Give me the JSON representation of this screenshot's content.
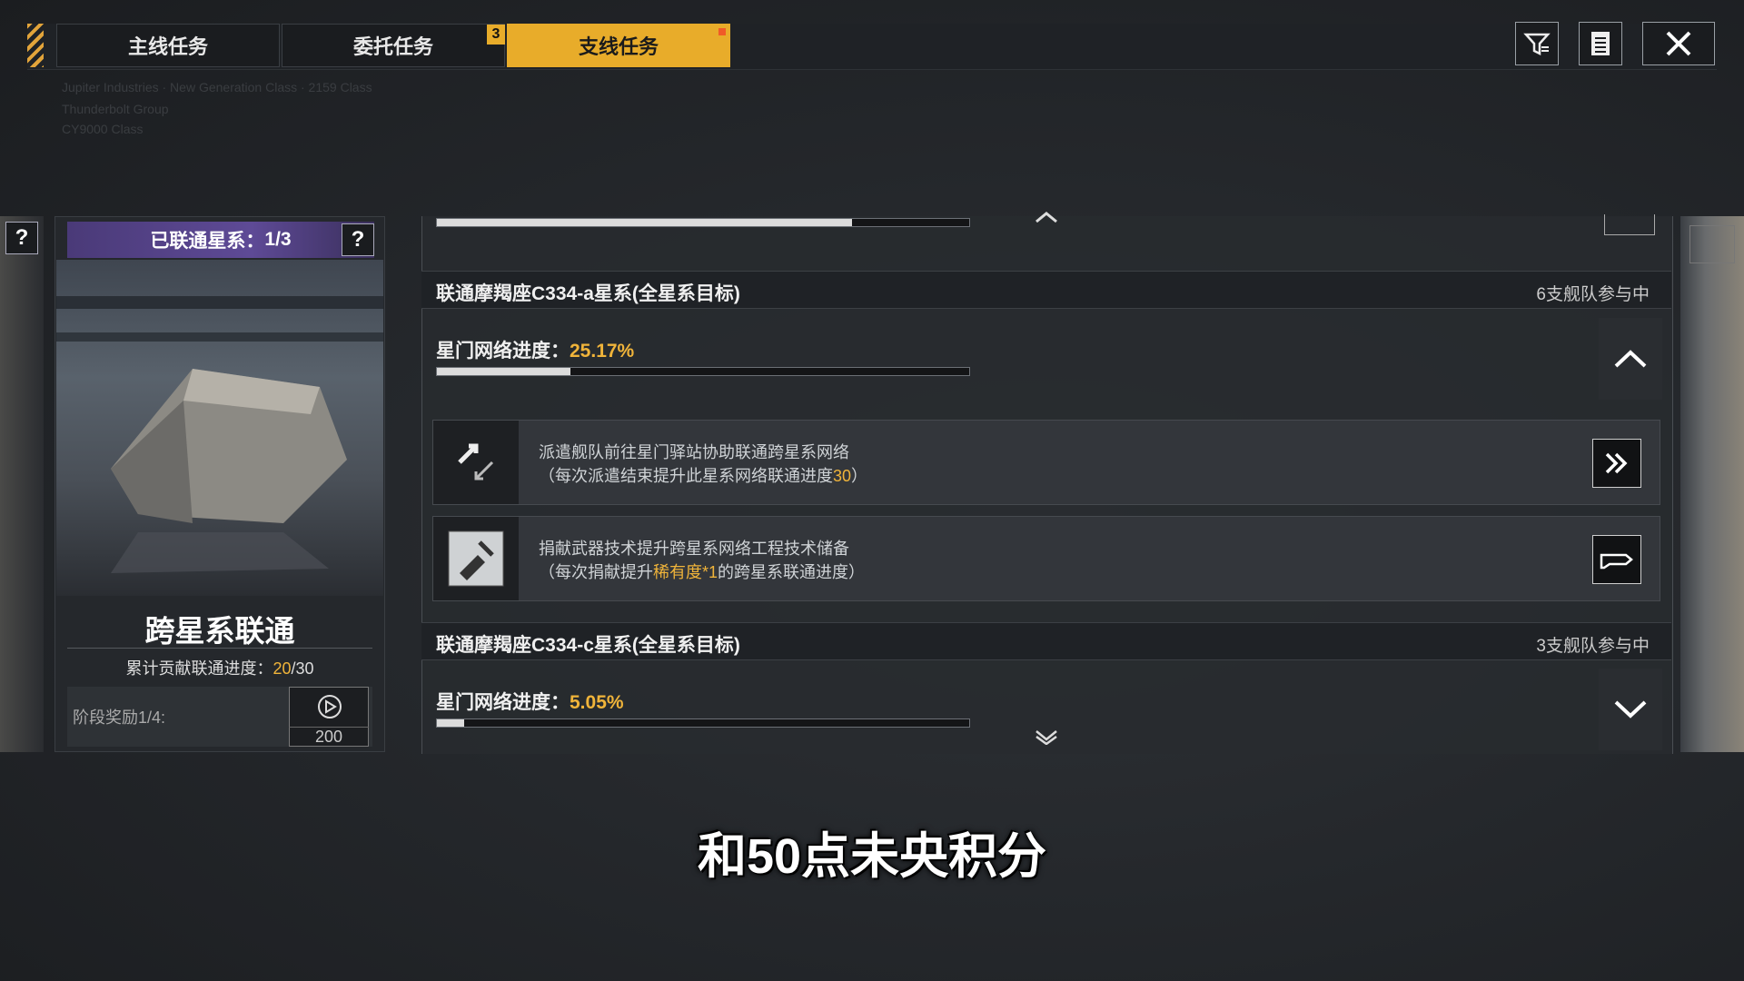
{
  "tabs": [
    {
      "label": "主线任务",
      "active": false
    },
    {
      "label": "委托任务",
      "active": false,
      "badge": "3"
    },
    {
      "label": "支线任务",
      "active": true
    }
  ],
  "header_faint_text": [
    "Jupiter Industries · New Generation Class · 2159 Class",
    "Thunderbolt Group",
    "CY9000 Class"
  ],
  "top_buttons": {
    "filter_icon": "filter-icon",
    "list_icon": "list-icon",
    "close_icon": "close-icon"
  },
  "left_card": {
    "connected_label": "已联通星系：",
    "connected_value": "1/3",
    "title": "跨星系联通",
    "contrib_label": "累计贡献联通进度：",
    "contrib_current": "20",
    "contrib_total": "/30",
    "stage_label": "阶段奖励1/4:",
    "reward_value": "200",
    "help_icon": "?"
  },
  "top_partial_progress": 0.78,
  "sections": [
    {
      "title": "联通摩羯座C334-a星系(全星系目标)",
      "fleet_text": "6支舰队参与中",
      "progress_label": "星门网络进度：",
      "progress_value": "25.17%",
      "progress_fraction": 0.2517,
      "expanded": true
    },
    {
      "title": "联通摩羯座C334-c星系(全星系目标)",
      "fleet_text": "3支舰队参与中",
      "progress_label": "星门网络进度：",
      "progress_value": "5.05%",
      "progress_fraction": 0.0505,
      "expanded": false
    }
  ],
  "tasks": [
    {
      "line1": "派遣舰队前往星门驿站协助联通跨星系网络",
      "line2_pre": "（每次派遣结束提升此星系网络联通进度",
      "line2_hl": "30",
      "line2_post": "）"
    },
    {
      "line1": "捐献武器技术提升跨星系网络工程技术储备",
      "line2_pre": "（每次捐献提升",
      "line2_hl": "稀有度*1",
      "line2_post": "的跨星系联通进度）"
    }
  ],
  "subtitle": "和50点未央积分",
  "colors": {
    "accent": "#e8ac2a",
    "highlight": "#f0b43a",
    "purple": "#5e4a96"
  }
}
